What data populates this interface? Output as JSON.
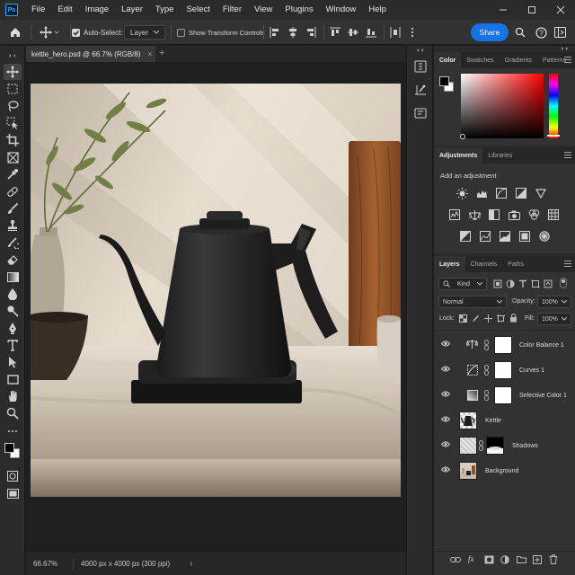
{
  "app": {
    "logo": "Ps",
    "menu": [
      "File",
      "Edit",
      "Image",
      "Layer",
      "Type",
      "Select",
      "Filter",
      "View",
      "Plugins",
      "Window",
      "Help"
    ]
  },
  "options": {
    "auto_select_label": "Auto-Select:",
    "auto_select_checked": true,
    "target": "Layer",
    "transform_controls_label": "Show Transform Controls",
    "transform_controls_checked": false,
    "share_label": "Share"
  },
  "document": {
    "tab_title": "kettle_hero.psd @ 66.7% (RGB/8)",
    "close": "×",
    "add_tab": "+",
    "zoom": "66.67%",
    "info": "4000 px x 4000 px (300 ppi)",
    "info_arrow": "›"
  },
  "color_panel": {
    "tabs": [
      "Color",
      "Swatches",
      "Gradients",
      "Patterns"
    ],
    "foreground_color": "#000000",
    "background_color": "#ffffff",
    "hue_color": "#ff0000"
  },
  "adjustments_panel": {
    "tabs": [
      "Adjustments",
      "Libraries"
    ],
    "heading": "Add an adjustment"
  },
  "layers_panel": {
    "tabs": [
      "Layers",
      "Channels",
      "Paths"
    ],
    "filter_kind": "Kind",
    "blend_mode": "Normal",
    "opacity_label": "Opacity:",
    "opacity_value": "100%",
    "lock_label": "Lock:",
    "fill_label": "Fill:",
    "fill_value": "100%",
    "layers": [
      {
        "name": "Color Balance 1",
        "kind": "adjustment",
        "icon": "color-balance-icon"
      },
      {
        "name": "Curves 1",
        "kind": "adjustment",
        "icon": "curves-icon"
      },
      {
        "name": "Selective Color 1",
        "kind": "adjustment",
        "icon": "selective-color-icon"
      },
      {
        "name": "Kettle",
        "kind": "pixel"
      },
      {
        "name": "Shadows",
        "kind": "masked"
      },
      {
        "name": "Background",
        "kind": "photo"
      }
    ],
    "footer_fx": "fx"
  }
}
